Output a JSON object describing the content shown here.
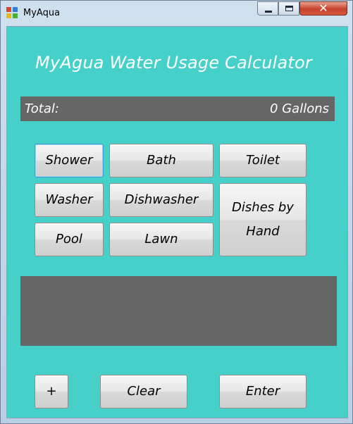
{
  "window": {
    "title": "MyAqua",
    "controls": {
      "minimize": "minimize",
      "maximize": "maximize",
      "close": "✕"
    }
  },
  "app": {
    "heading": "MyAgua Water Usage Calculator",
    "total": {
      "label": "Total:",
      "value": "0 Gallons"
    },
    "activities": {
      "shower": "Shower",
      "bath": "Bath",
      "toilet": "Toilet",
      "washer": "Washer",
      "dishwasher": "Dishwasher",
      "dishes_by_hand": "Dishes by\nHand",
      "pool": "Pool",
      "lawn": "Lawn"
    },
    "actions": {
      "plus": "+",
      "clear": "Clear",
      "enter": "Enter"
    }
  },
  "colors": {
    "client_background": "#45d0ca",
    "panel_gray": "#666666",
    "heading_text": "#ffffff"
  }
}
